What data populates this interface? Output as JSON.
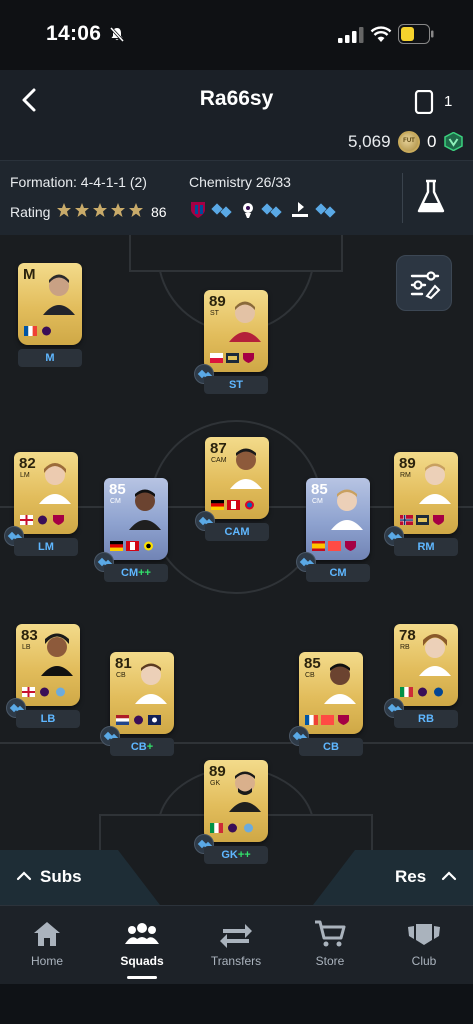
{
  "status_bar": {
    "time": "14:06"
  },
  "header": {
    "title": "Ra66sy",
    "phone_count": "1",
    "coins": "5,069",
    "coin_label": "FUT",
    "points": "0"
  },
  "info": {
    "formation": "Formation: 4-4-1-1 (2)",
    "rating_label": "Rating",
    "rating_value": "86",
    "stars": 5,
    "chemistry": "Chemistry 26/33"
  },
  "players": [
    {
      "id": "m",
      "rating": "",
      "position": "M",
      "label": "M",
      "plus": "",
      "card": "gold",
      "badge": false
    },
    {
      "id": "st",
      "rating": "89",
      "position": "ST",
      "label": "ST",
      "plus": "",
      "card": "gold",
      "badge": true
    },
    {
      "id": "lm",
      "rating": "82",
      "position": "LM",
      "label": "LM",
      "plus": "",
      "card": "gold",
      "badge": true
    },
    {
      "id": "cam",
      "rating": "87",
      "position": "CAM",
      "label": "CAM",
      "plus": "",
      "card": "gold",
      "badge": true
    },
    {
      "id": "rm",
      "rating": "89",
      "position": "RM",
      "label": "RM",
      "plus": "",
      "card": "gold",
      "badge": true
    },
    {
      "id": "cm-left",
      "rating": "85",
      "position": "CM",
      "label": "CM",
      "plus": "++",
      "card": "blue",
      "badge": true
    },
    {
      "id": "cm-right",
      "rating": "85",
      "position": "CM",
      "label": "CM",
      "plus": "",
      "card": "blue",
      "badge": true
    },
    {
      "id": "lb",
      "rating": "83",
      "position": "LB",
      "label": "LB",
      "plus": "",
      "card": "gold",
      "badge": true
    },
    {
      "id": "rb",
      "rating": "78",
      "position": "RB",
      "label": "RB",
      "plus": "",
      "card": "gold",
      "badge": true
    },
    {
      "id": "cb-left",
      "rating": "81",
      "position": "CB",
      "label": "CB",
      "plus": "+",
      "card": "gold",
      "badge": true
    },
    {
      "id": "cb-right",
      "rating": "85",
      "position": "CB",
      "label": "CB",
      "plus": "",
      "card": "gold",
      "badge": true
    },
    {
      "id": "gk",
      "rating": "89",
      "position": "GK",
      "label": "GK",
      "plus": "++",
      "card": "gold",
      "badge": true
    }
  ],
  "subs": {
    "label": "Subs"
  },
  "res": {
    "label": "Res"
  },
  "nav": {
    "home": "Home",
    "squads": "Squads",
    "transfers": "Transfers",
    "store": "Store",
    "club": "Club",
    "active": "squads"
  },
  "colors": {
    "accent_blue": "#5fb7ff",
    "plus_green": "#33e06b",
    "gold_card": "#e2bd5c",
    "blue_card": "#8ea2cf"
  },
  "icons": [
    "back-arrow-icon",
    "phone-icon",
    "coin-icon",
    "points-icon",
    "star-icon",
    "flask-icon",
    "filter-icon",
    "chemistry-icon",
    "chevron-up-icon",
    "home-icon",
    "squads-icon",
    "transfers-icon",
    "store-icon",
    "club-icon"
  ]
}
